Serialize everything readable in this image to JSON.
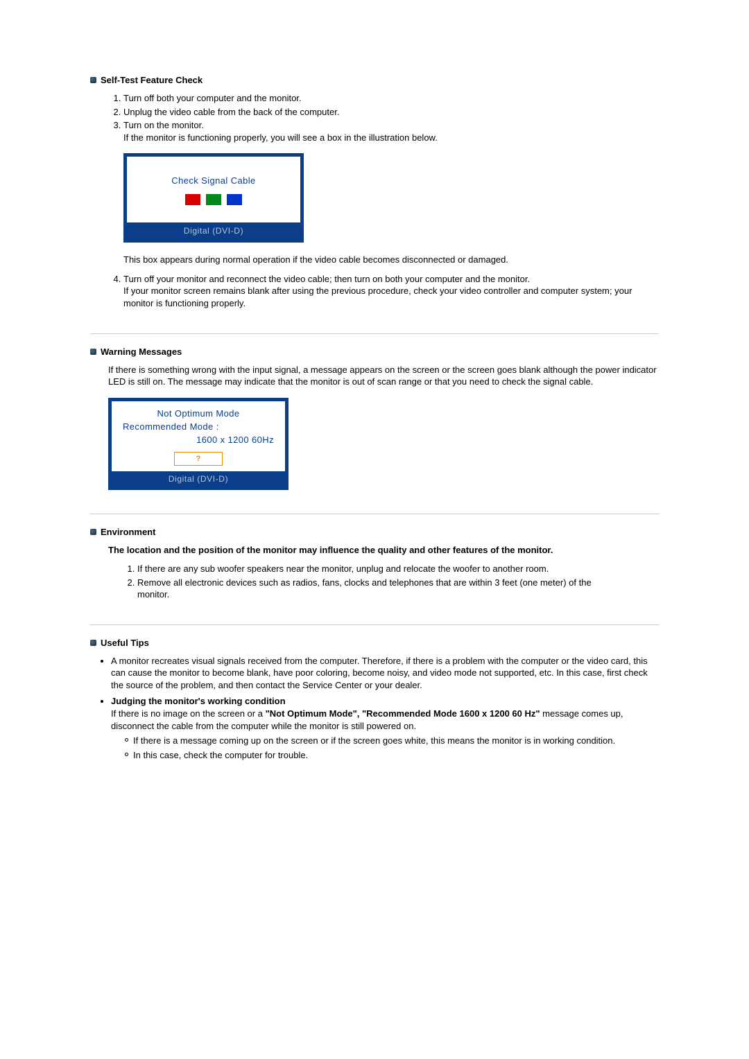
{
  "selftest": {
    "heading": "Self-Test Feature Check",
    "steps": {
      "s1": "Turn off both your computer and the monitor.",
      "s2": "Unplug the video cable from the back of the computer.",
      "s3a": "Turn on the monitor.",
      "s3b": "If the monitor is functioning properly, you will see a box in the illustration below.",
      "s4a": "Turn off your monitor and reconnect the video cable; then turn on both your computer and the monitor.",
      "s4b": "If your monitor screen remains blank after using the previous procedure, check your video controller and computer system; your monitor is functioning properly."
    },
    "box": {
      "message": "Check Signal Cable",
      "footer": "Digital (DVI-D)"
    },
    "box_caption": "This box appears during normal operation if the video cable becomes disconnected or damaged."
  },
  "warning": {
    "heading": "Warning Messages",
    "para": "If there is something wrong with the input signal, a message appears on the screen or the screen goes blank although the power indicator LED is still on. The message may indicate that the monitor is out of scan range or that you need to check the signal cable.",
    "box": {
      "line1": "Not Optimum Mode",
      "line2": "Recommended Mode :",
      "line3": "1600 x 1200 60Hz",
      "q": "?",
      "footer": "Digital (DVI-D)"
    }
  },
  "environment": {
    "heading": "Environment",
    "intro": "The location and the position of the monitor may influence the quality and other features of the monitor.",
    "items": {
      "e1": "If there are any sub woofer speakers near the monitor, unplug and relocate the woofer to another room.",
      "e2": "Remove all electronic devices such as radios, fans, clocks and telephones that are within 3 feet (one meter) of the monitor."
    }
  },
  "tips": {
    "heading": "Useful Tips",
    "bullet1": "A monitor recreates visual signals received from the computer. Therefore, if there is a problem with the computer or the video card, this can cause the monitor to become blank, have poor coloring, become noisy, and video mode not supported, etc. In this case, first check the source of the problem, and then contact the Service Center or your dealer.",
    "bullet2_title": "Judging the monitor's working condition",
    "bullet2_pre": "If there is no image on the screen or a ",
    "bullet2_bold": "\"Not Optimum Mode\", \"Recommended Mode 1600 x 1200 60 Hz\"",
    "bullet2_post": " message comes up, disconnect the cable from the computer while the monitor is still powered on.",
    "sub1": "If there is a message coming up on the screen or if the screen goes white, this means the monitor is in working condition.",
    "sub2": "In this case, check the computer for trouble."
  },
  "colors": {
    "red": "#d80000",
    "green": "#008a1a",
    "blue": "#0033cc"
  }
}
